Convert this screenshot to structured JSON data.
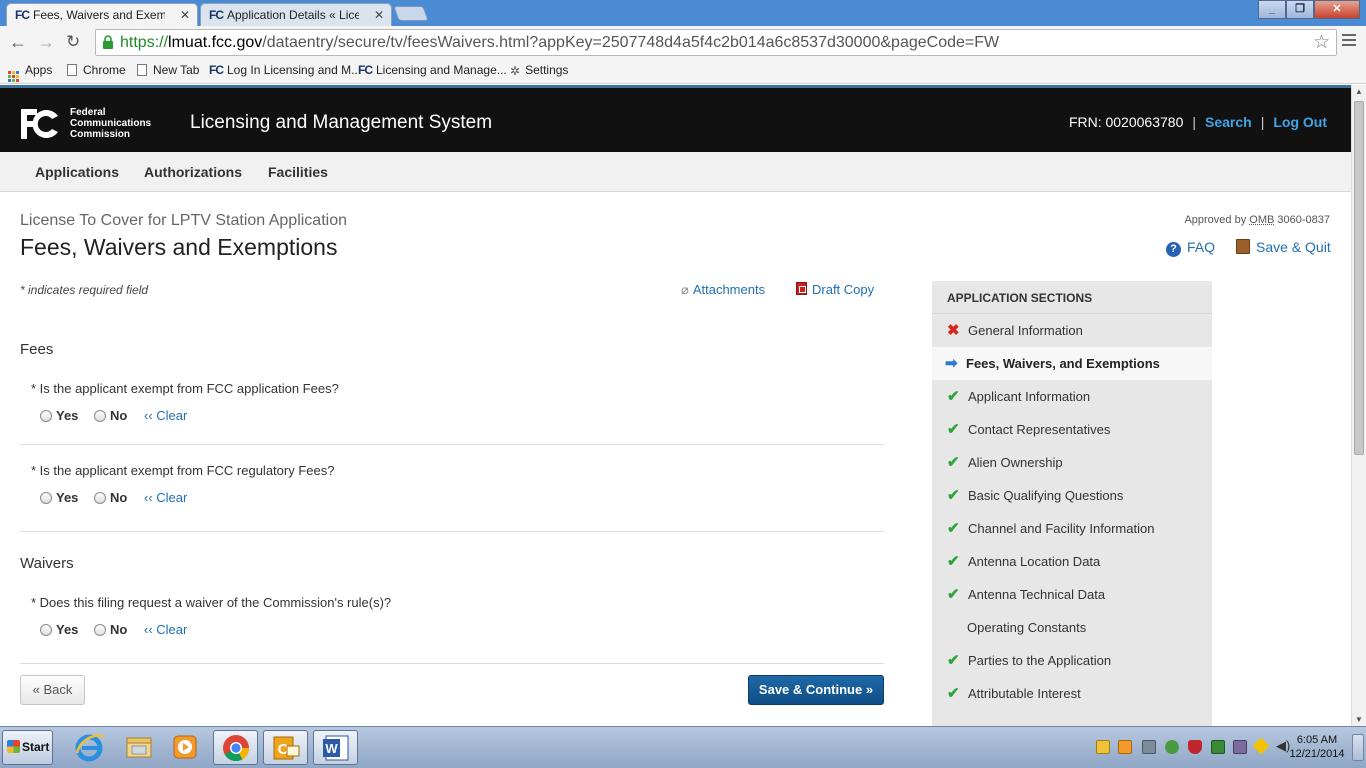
{
  "browser": {
    "tabs": [
      {
        "favicon": "FC",
        "title": "Fees, Waivers and Exemptio",
        "active": true
      },
      {
        "favicon": "FC",
        "title": "Application Details « Licensin",
        "active": false
      }
    ],
    "window_buttons": [
      "_",
      "❐",
      "✕"
    ],
    "url": {
      "protocol": "https://",
      "host": "lmuat.fcc.gov",
      "path": "/dataentry/secure/tv/feesWaivers.html?appKey=2507748d4a5f4c2b014a6c8537d30000&pageCode=FW"
    },
    "bookmarks": [
      {
        "label": "Apps",
        "icon": "apps-grid-icon"
      },
      {
        "label": "Chrome",
        "icon": "page-icon"
      },
      {
        "label": "New Tab",
        "icon": "page-icon"
      },
      {
        "label": "Log In Licensing and M...",
        "icon": "fcc-favicon"
      },
      {
        "label": "Licensing and Manage...",
        "icon": "fcc-favicon"
      },
      {
        "label": "Settings",
        "icon": "gear-icon"
      }
    ]
  },
  "header": {
    "agency_lines": [
      "Federal",
      "Communications",
      "Commission"
    ],
    "system_title": "Licensing and Management System",
    "frn": "FRN: 0020063780",
    "search": "Search",
    "logout": "Log Out"
  },
  "nav": [
    "Applications",
    "Authorizations",
    "Facilities"
  ],
  "page": {
    "app_type": "License To Cover for LPTV Station Application",
    "title": "Fees, Waivers and Exemptions",
    "omb_prefix": "Approved by",
    "omb_abbr": "OMB",
    "omb_number": "3060-0837",
    "faq": "FAQ",
    "save_quit": "Save & Quit",
    "required_note": "* indicates required field",
    "attachments": "Attachments",
    "draft_copy": "Draft Copy"
  },
  "form": {
    "fees_heading": "Fees",
    "q1": "* Is the applicant exempt from FCC application Fees?",
    "q2": "* Is the applicant exempt from FCC regulatory Fees?",
    "waivers_heading": "Waivers",
    "q3": "* Does this filing request a waiver of the Commission's rule(s)?",
    "yes": "Yes",
    "no": "No",
    "clear": "‹‹ Clear",
    "back": "« Back",
    "save_continue": "Save & Continue »"
  },
  "sidebar": {
    "heading": "APPLICATION SECTIONS",
    "items": [
      {
        "label": "General Information",
        "status": "error"
      },
      {
        "label": "Fees, Waivers, and Exemptions",
        "status": "current"
      },
      {
        "label": "Applicant Information",
        "status": "complete"
      },
      {
        "label": "Contact Representatives",
        "status": "complete"
      },
      {
        "label": "Alien Ownership",
        "status": "complete"
      },
      {
        "label": "Basic Qualifying Questions",
        "status": "complete"
      },
      {
        "label": "Channel and Facility Information",
        "status": "complete"
      },
      {
        "label": "Antenna Location Data",
        "status": "complete"
      },
      {
        "label": "Antenna Technical Data",
        "status": "complete"
      },
      {
        "label": "Operating Constants",
        "status": "none"
      },
      {
        "label": "Parties to the Application",
        "status": "complete"
      },
      {
        "label": "Attributable Interest",
        "status": "complete"
      }
    ]
  },
  "taskbar": {
    "start": "Start",
    "apps": [
      "internet-explorer",
      "windows-explorer",
      "media-player",
      "chrome",
      "outlook",
      "word"
    ],
    "time": "6:05 AM",
    "date": "12/21/2014"
  },
  "colors": {
    "link": "#1f6fb2",
    "header_bg": "#111111",
    "primary_button": "#14568f",
    "check": "#2ea43a",
    "error": "#d9261c"
  }
}
